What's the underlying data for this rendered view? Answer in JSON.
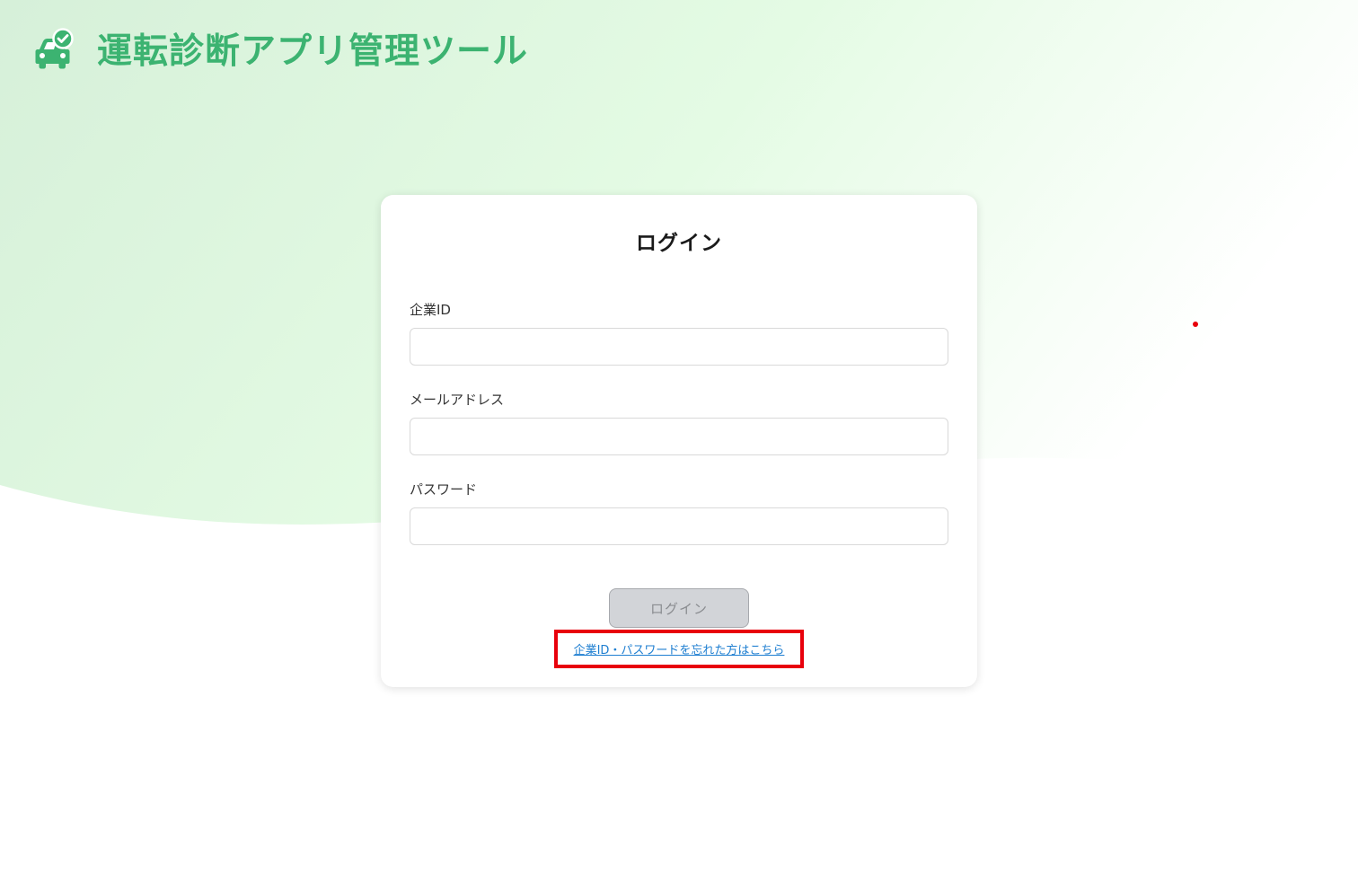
{
  "header": {
    "logo_icon": "car-check-icon",
    "title": "運転診断アプリ管理ツール"
  },
  "login_form": {
    "title": "ログイン",
    "fields": [
      {
        "label": "企業ID",
        "value": "",
        "placeholder": ""
      },
      {
        "label": "メールアドレス",
        "value": "",
        "placeholder": ""
      },
      {
        "label": "パスワード",
        "value": "",
        "placeholder": ""
      }
    ],
    "submit_label": "ログイン",
    "submit_state": "disabled",
    "forgot_link_label": "企業ID・パスワードを忘れた方はこちら"
  },
  "colors": {
    "brand_green": "#3cb371",
    "background_green_light": "#e6fbe6",
    "background_green_mid": "#d4f0d8",
    "link_blue": "#1f7fd1",
    "highlight_red": "#e8000b",
    "button_disabled_bg": "#d2d4d8",
    "button_disabled_text": "#8a8c90"
  }
}
